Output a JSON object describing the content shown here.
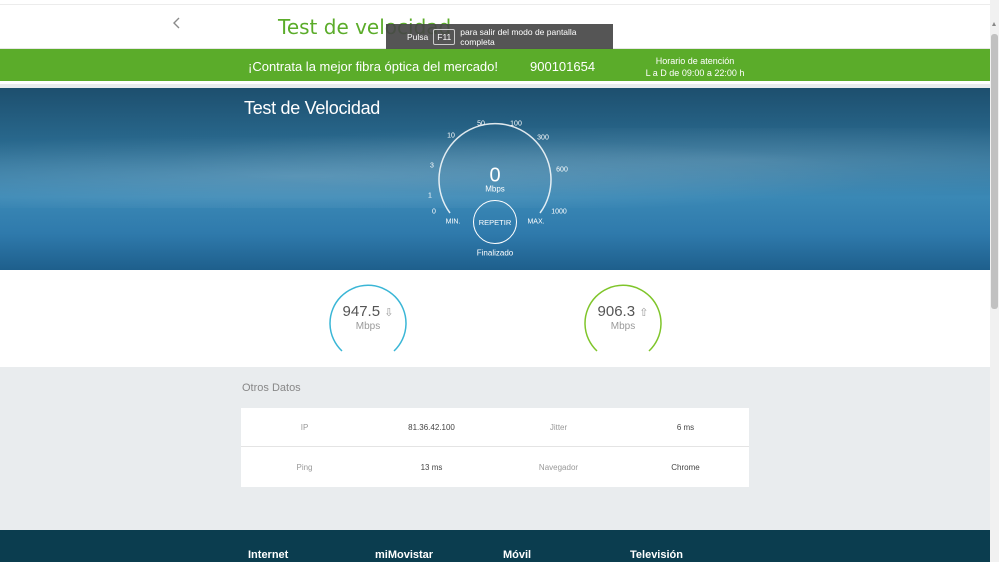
{
  "header": {
    "title": "Test de velocidad",
    "back_icon": "chevron-left-icon"
  },
  "toast": {
    "prefix": "Pulsa",
    "key": "F11",
    "suffix": "para salir del modo de pantalla completa"
  },
  "promo": {
    "cta": "¡Contrata la mejor fibra óptica del mercado!",
    "phone": "900101654",
    "hours_title": "Horario de atención",
    "hours_value": "L a D de 09:00 a 22:00 h",
    "color": "#5bac2a"
  },
  "hero": {
    "title": "Test de Velocidad",
    "gauge": {
      "ticks": [
        "0",
        "1",
        "3",
        "10",
        "50",
        "100",
        "300",
        "600",
        "1000"
      ],
      "value": "0",
      "unit": "Mbps",
      "min_label": "MIN.",
      "max_label": "MAX.",
      "repeat_label": "REPETIR",
      "status": "Finalizado"
    }
  },
  "results": {
    "download": {
      "value": "947.5",
      "unit": "Mbps",
      "icon": "arrow-down-icon",
      "color": "#3ab6d6"
    },
    "upload": {
      "value": "906.3",
      "unit": "Mbps",
      "icon": "arrow-up-icon",
      "color": "#7fc52a"
    }
  },
  "otros": {
    "title": "Otros Datos",
    "rows": [
      [
        {
          "label": "IP",
          "value": "81.36.42.100"
        },
        {
          "label": "Jitter",
          "value": "6 ms"
        }
      ],
      [
        {
          "label": "Ping",
          "value": "13 ms"
        },
        {
          "label": "Navegador",
          "value": "Chrome"
        }
      ]
    ]
  },
  "footer": {
    "links": [
      "Internet",
      "miMovistar",
      "Móvil",
      "Televisión"
    ]
  }
}
